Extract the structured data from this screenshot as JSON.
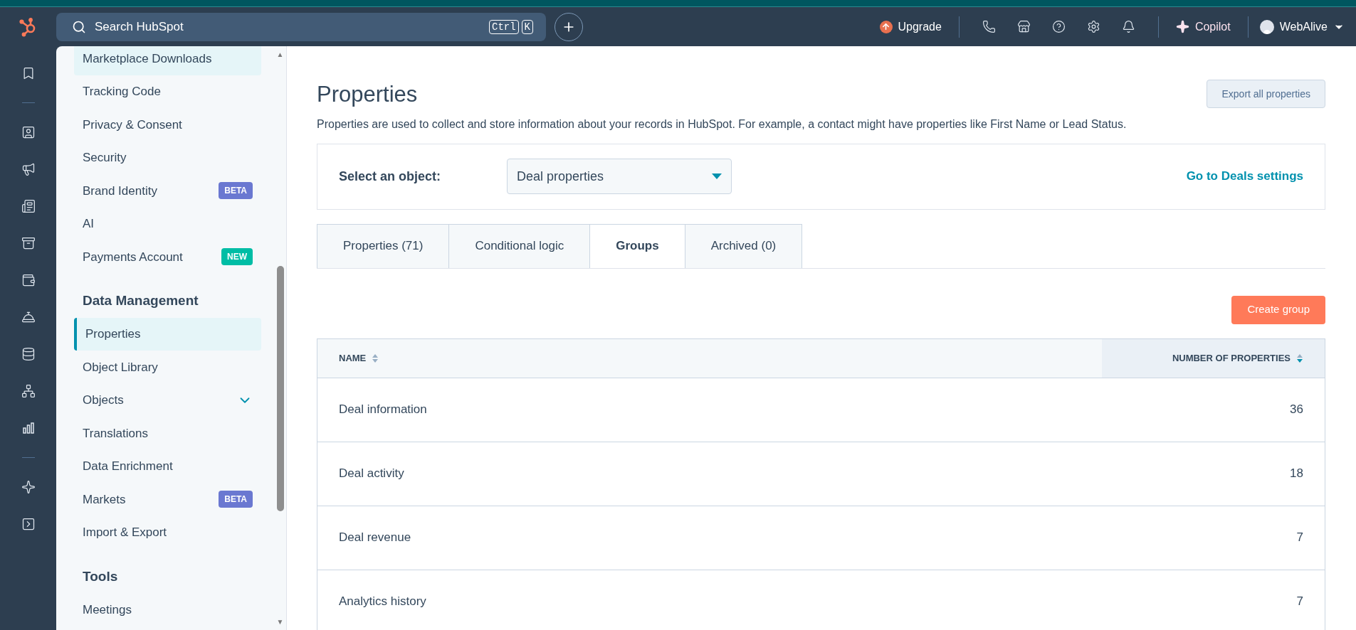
{
  "top_bar": {
    "search": {
      "placeholder": "Search HubSpot",
      "shortcut_keys": [
        "Ctrl",
        "K"
      ]
    },
    "upgrade": "Upgrade",
    "copilot": "Copilot",
    "account": "WebAlive"
  },
  "scrollbar_arrows": [
    "▲",
    "▼"
  ],
  "sidebar": {
    "sections": [
      {
        "items": [
          {
            "label": "Marketplace Downloads",
            "selected": false,
            "hovered": true
          },
          {
            "label": "Tracking Code",
            "selected": false
          },
          {
            "label": "Privacy & Consent",
            "selected": false
          },
          {
            "label": "Security",
            "selected": false
          },
          {
            "label": "Brand Identity",
            "selected": false,
            "badge": {
              "text": "BETA",
              "color": "#6a78d1"
            }
          },
          {
            "label": "AI",
            "selected": false
          },
          {
            "label": "Payments Account",
            "selected": false,
            "badge": {
              "text": "NEW",
              "color": "#00bda5"
            }
          }
        ]
      },
      {
        "heading": "Data Management",
        "items": [
          {
            "label": "Properties",
            "selected": true
          },
          {
            "label": "Object Library",
            "selected": false
          },
          {
            "label": "Objects",
            "selected": false,
            "expandable": true
          },
          {
            "label": "Translations",
            "selected": false
          },
          {
            "label": "Data Enrichment",
            "selected": false
          },
          {
            "label": "Markets",
            "selected": false,
            "badge": {
              "text": "BETA",
              "color": "#6a78d1"
            }
          },
          {
            "label": "Import & Export",
            "selected": false
          }
        ]
      },
      {
        "heading": "Tools",
        "items": [
          {
            "label": "Meetings",
            "selected": false
          }
        ]
      }
    ]
  },
  "page": {
    "title": "Properties",
    "export_button": "Export all properties",
    "description": "Properties are used to collect and store information about your records in HubSpot. For example, a contact might have properties like First Name or Lead Status.",
    "object_select": {
      "label": "Select an object:",
      "value": "Deal properties",
      "link": "Go to Deals settings"
    },
    "tabs": [
      {
        "label": "Properties (71)",
        "selected": false
      },
      {
        "label": "Conditional logic",
        "selected": false
      },
      {
        "label": "Groups",
        "selected": true
      },
      {
        "label": "Archived (0)",
        "selected": false
      }
    ],
    "create_button": "Create group",
    "table": {
      "columns": [
        {
          "label": "NAME",
          "sorted": false
        },
        {
          "label": "NUMBER OF PROPERTIES",
          "sorted": true
        }
      ],
      "rows": [
        {
          "name": "Deal information",
          "count": "36"
        },
        {
          "name": "Deal activity",
          "count": "18"
        },
        {
          "name": "Deal revenue",
          "count": "7"
        },
        {
          "name": "Analytics history",
          "count": "7"
        }
      ]
    }
  }
}
